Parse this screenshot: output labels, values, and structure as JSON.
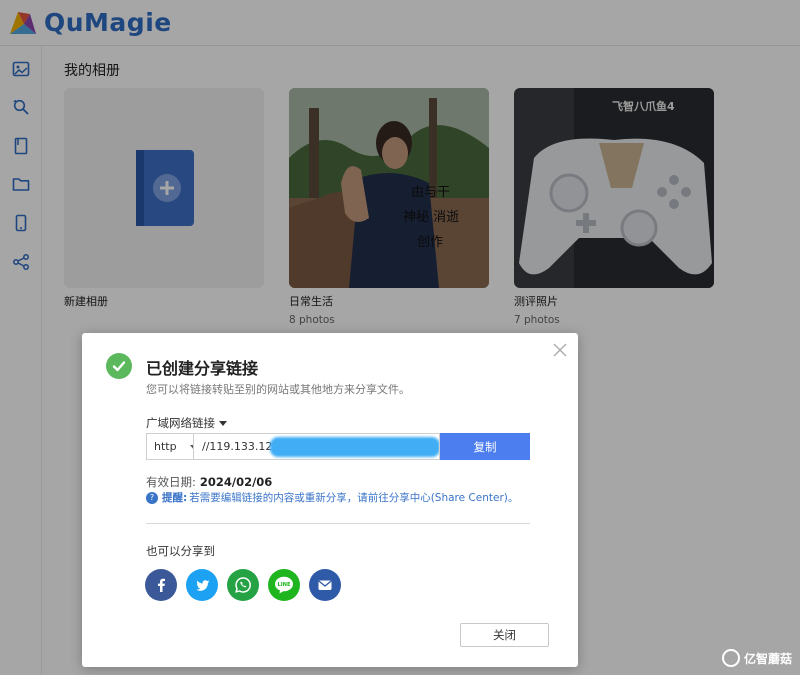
{
  "app": {
    "brand": "QuMagie"
  },
  "sidebar": {
    "items": [
      {
        "icon": "photos-icon"
      },
      {
        "icon": "smart-search-icon"
      },
      {
        "icon": "album-icon"
      },
      {
        "icon": "folder-icon"
      },
      {
        "icon": "device-icon"
      },
      {
        "icon": "share-icon"
      }
    ]
  },
  "main": {
    "section_title": "我的相册",
    "albums": [
      {
        "name": "新建相册",
        "count": ""
      },
      {
        "name": "日常生活",
        "count": "8 photos",
        "overlay_text": [
          "由与干",
          "神秘 消逝",
          "创作"
        ]
      },
      {
        "name": "测评照片",
        "count": "7 photos",
        "box_text": "飞智八爪鱼4"
      }
    ]
  },
  "dialog": {
    "title": "已创建分享链接",
    "subtitle": "您可以将链接转贴至别的网站或其他地方来分享文件。",
    "link_type_label": "广域网络链接",
    "protocol": "http",
    "url_prefix": "//119.133.12",
    "copy_label": "复制",
    "expiry_label": "有效日期:",
    "expiry_value": "2024/02/06",
    "tip_label": "提醒:",
    "tip_text": "若需要编辑链接的内容或重新分享，请前往分享中心(Share Center)。",
    "share_label": "也可以分享到",
    "close_label": "关闭",
    "socials": [
      {
        "name": "facebook",
        "color": "#3b5998",
        "glyph": "f"
      },
      {
        "name": "twitter",
        "color": "#1da1f2",
        "glyph": ""
      },
      {
        "name": "whatsapp",
        "color": "#25a244",
        "glyph": ""
      },
      {
        "name": "line",
        "color": "#1eb51e",
        "glyph": "LINE"
      },
      {
        "name": "email",
        "color": "#2f5aa8",
        "glyph": ""
      }
    ]
  },
  "watermark": {
    "text": "亿智蘑菇"
  },
  "colors": {
    "accent": "#4d7ef0",
    "brand": "#2f6cc4",
    "success": "#5cb85c"
  }
}
